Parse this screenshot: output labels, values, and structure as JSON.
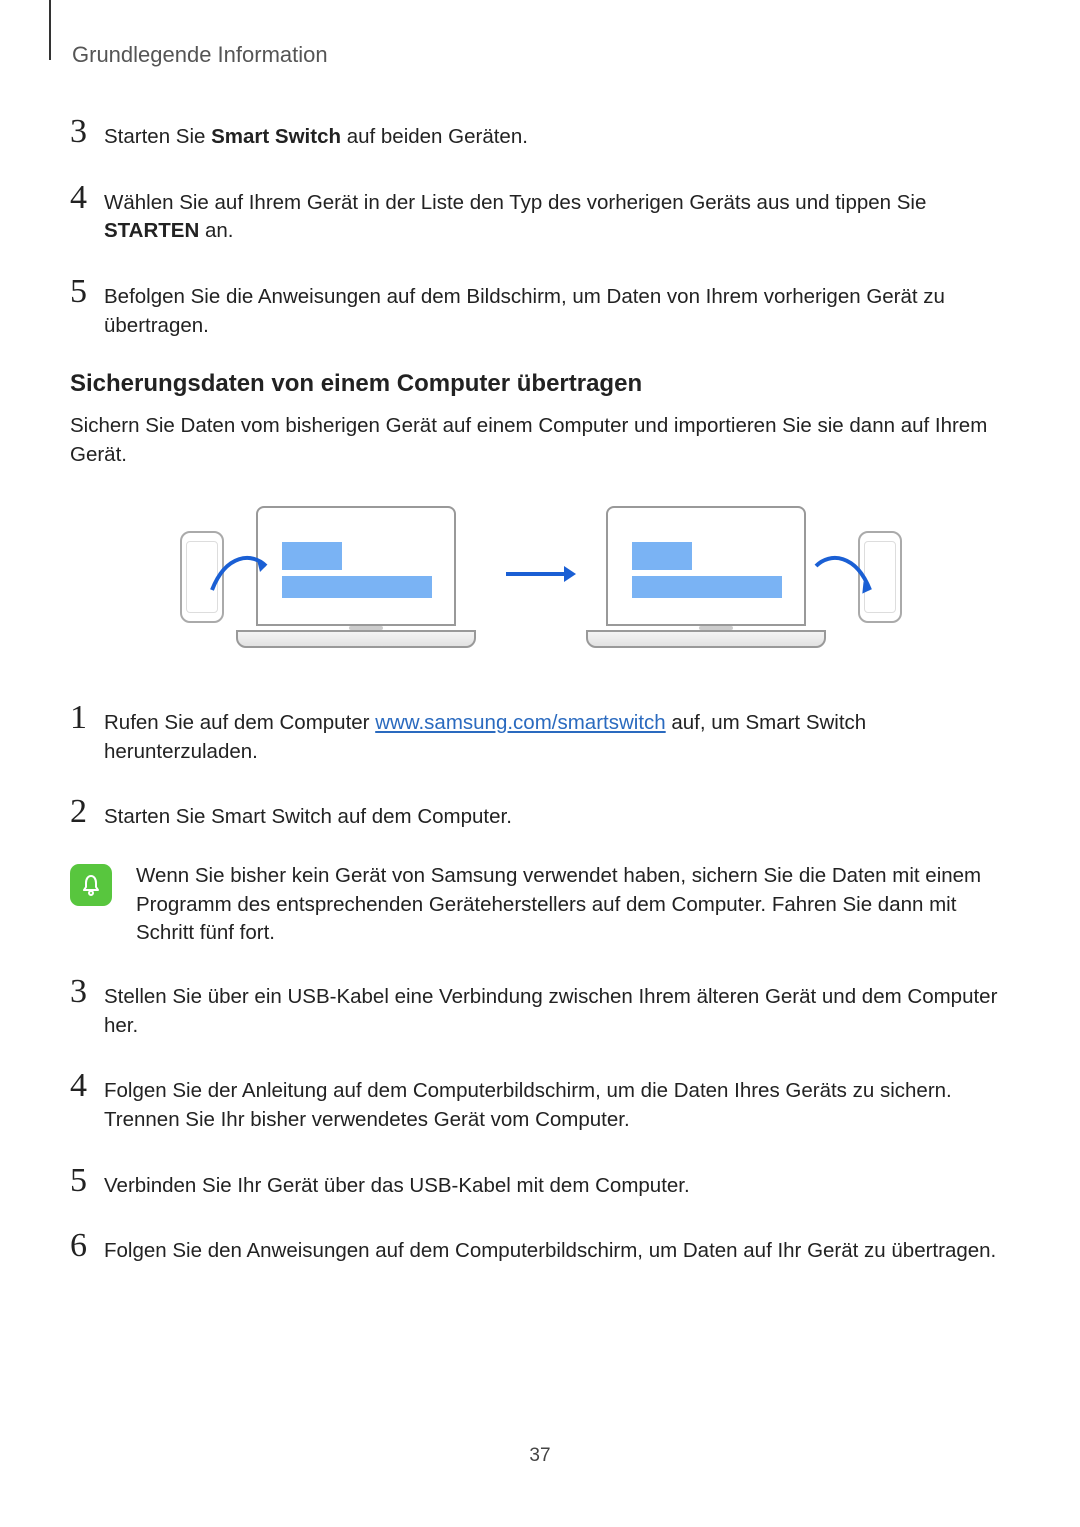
{
  "header": {
    "section_label": "Grundlegende Information"
  },
  "steps_a": {
    "s3": {
      "num": "3",
      "pre": "Starten Sie ",
      "bold": "Smart Switch",
      "post": " auf beiden Geräten."
    },
    "s4": {
      "num": "4",
      "pre": "Wählen Sie auf Ihrem Gerät in der Liste den Typ des vorherigen Geräts aus und tippen Sie ",
      "bold": "STARTEN",
      "post": " an."
    },
    "s5": {
      "num": "5",
      "text": "Befolgen Sie die Anweisungen auf dem Bildschirm, um Daten von Ihrem vorherigen Gerät zu übertragen."
    }
  },
  "subheading": "Sicherungsdaten von einem Computer übertragen",
  "intro": "Sichern Sie Daten vom bisherigen Gerät auf einem Computer und importieren Sie sie dann auf Ihrem Gerät.",
  "link": "www.samsung.com/smartswitch",
  "steps_b": {
    "s1": {
      "num": "1",
      "pre": "Rufen Sie auf dem Computer ",
      "post": " auf, um Smart Switch herunterzuladen."
    },
    "s2": {
      "num": "2",
      "text": "Starten Sie Smart Switch auf dem Computer."
    },
    "s3": {
      "num": "3",
      "text": "Stellen Sie über ein USB-Kabel eine Verbindung zwischen Ihrem älteren Gerät und dem Computer her."
    },
    "s4": {
      "num": "4",
      "text": "Folgen Sie der Anleitung auf dem Computerbildschirm, um die Daten Ihres Geräts zu sichern. Trennen Sie Ihr bisher verwendetes Gerät vom Computer."
    },
    "s5": {
      "num": "5",
      "text": "Verbinden Sie Ihr Gerät über das USB-Kabel mit dem Computer."
    },
    "s6": {
      "num": "6",
      "text": "Folgen Sie den Anweisungen auf dem Computerbildschirm, um Daten auf Ihr Gerät zu übertragen."
    }
  },
  "note": "Wenn Sie bisher kein Gerät von Samsung verwendet haben, sichern Sie die Daten mit einem Programm des entsprechenden Geräteherstellers auf dem Computer. Fahren Sie dann mit Schritt fünf fort.",
  "page_number": "37",
  "figure_alt": "Phone transferring backup data to laptop (left), then laptop restoring data to new phone (right)"
}
